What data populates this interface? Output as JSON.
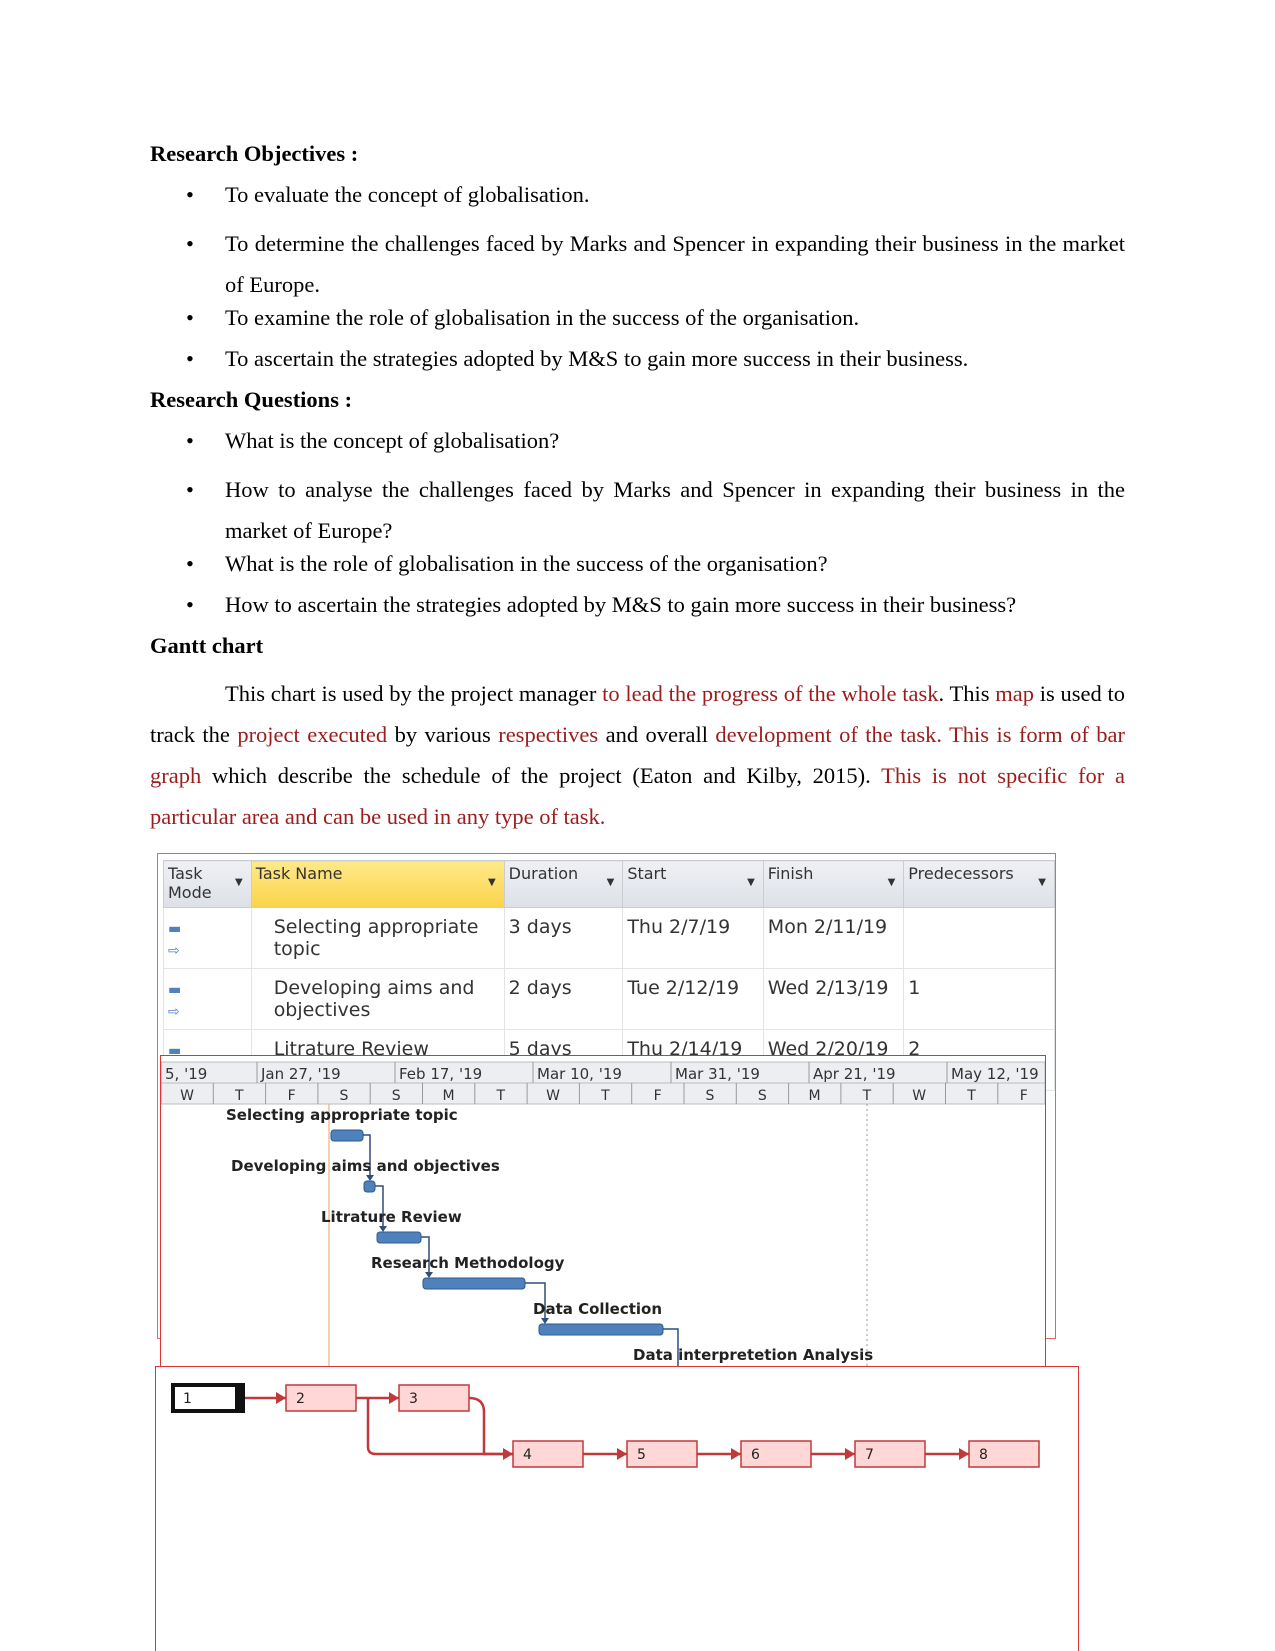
{
  "objectives": {
    "heading": "Research Objectives :",
    "items": [
      "To evaluate the concept of globalisation.",
      "To determine the challenges faced by Marks and Spencer in expanding their business in the market of Europe.",
      "To examine the role of globalisation in the success of the organisation.",
      "To ascertain the strategies adopted by M&S to gain more success in their business."
    ]
  },
  "questions": {
    "heading": "Research Questions :",
    "items": [
      "What is the concept of globalisation?",
      "How to analyse the challenges faced by Marks and Spencer in expanding their business in the market of Europe?",
      "What is the role of globalisation in the success of the organisation?",
      "How to ascertain the strategies adopted by M&S to gain more success in their business?"
    ]
  },
  "gantt_section": {
    "heading": "Gantt chart",
    "p": [
      "This chart is used by the project manager ",
      "to lead the progress of the whole task",
      ". This ",
      "map",
      " is used to track the ",
      "project executed",
      " by various ",
      "respectives",
      " and overall ",
      "development of the task.",
      " ",
      "This is form of bar graph",
      " which describe the schedule of the project (Eaton and Kilby, 2015). ",
      "This is not specific for a particular area and can be used in any type of task."
    ]
  },
  "table": {
    "headers": [
      "Task Mode",
      "Task Name",
      "Duration",
      "Start",
      "Finish",
      "Predecessors"
    ],
    "rows": [
      {
        "name": "Selecting appropriate topic",
        "duration": "3 days",
        "start": "Thu 2/7/19",
        "finish": "Mon 2/11/19",
        "pred": ""
      },
      {
        "name": "Developing aims and objectives",
        "duration": "2 days",
        "start": "Tue 2/12/19",
        "finish": "Wed 2/13/19",
        "pred": "1"
      },
      {
        "name": "Litrature Review",
        "duration": "5 days",
        "start": "Thu 2/14/19",
        "finish": "Wed 2/20/19",
        "pred": "2"
      }
    ]
  },
  "timescale": {
    "major": [
      "5, '19",
      "Jan 27, '19",
      "Feb 17, '19",
      "Mar 10, '19",
      "Mar 31, '19",
      "Apr 21, '19",
      "May 12, '19"
    ],
    "minor": [
      "W",
      "T",
      "F",
      "S",
      "S",
      "M",
      "T",
      "W",
      "T",
      "F",
      "S",
      "S",
      "M",
      "T",
      "W",
      "T",
      "F"
    ]
  },
  "gantt_tasks": [
    "Selecting appropriate topic",
    "Developing aims and objectives",
    "Litrature Review",
    "Research Methodology",
    "Data Collection",
    "Data interpretetion Analysis"
  ],
  "network_nodes": [
    "1",
    "2",
    "3",
    "4",
    "5",
    "6",
    "7",
    "8"
  ],
  "colors": {
    "accent_red": "#9b1c1c",
    "bar": "#4f81bd",
    "node_fill": "#ffd7d7",
    "node_border": "#c0393b"
  }
}
